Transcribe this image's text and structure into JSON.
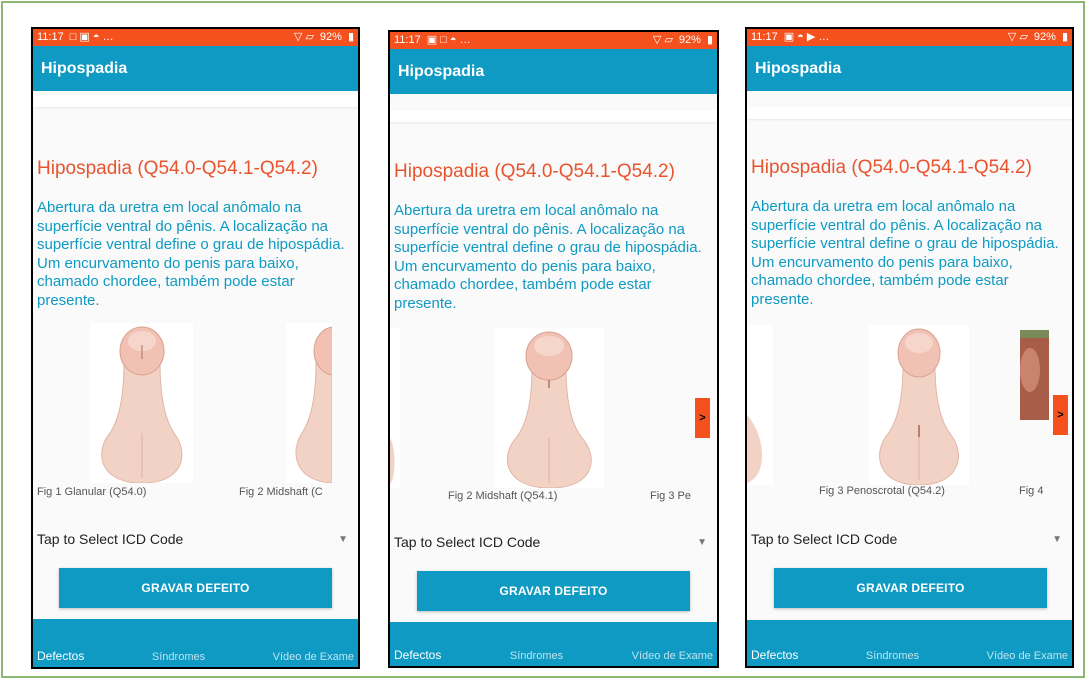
{
  "theme": {
    "status_bar": "#f4511e",
    "primary": "#0e9ac3",
    "accent": "#f4511e",
    "body_text": "#0e9ac3",
    "title_text": "#e8542e"
  },
  "screens": [
    {
      "status": {
        "time": "11:17",
        "left_icons": "□ ▣ ◓ …",
        "battery": "92%"
      },
      "app_title": "Hipospadia",
      "heading": "Hipospadia (Q54.0-Q54.1-Q54.2)",
      "description": "Abertura da uretra em local anômalo na superfície ventral do pênis. A localização na superfície ventral define o grau de hipospádia. Um encurvamento do penis para baixo, chamado chordee, também pode estar presente.",
      "captions": [
        "Fig 1 Glanular (Q54.0)",
        "Fig 2 Midshaft (C"
      ],
      "next_arrow": null,
      "select_label": "Tap to Select ICD Code",
      "button_label": "GRAVAR DEFEITO",
      "nav": {
        "active": "Defectos",
        "items": [
          "Síndromes",
          "Vídeo de Exame"
        ]
      }
    },
    {
      "status": {
        "time": "11:17",
        "left_icons": "▣ □ ◓ …",
        "battery": "92%"
      },
      "app_title": "Hipospadia",
      "heading": "Hipospadia (Q54.0-Q54.1-Q54.2)",
      "description": "Abertura da uretra em local anômalo na superfície ventral do pênis. A localização na superfície ventral define o grau de hipospádia. Um encurvamento do penis para baixo, chamado chordee, também pode estar presente.",
      "captions": [
        "Fig 2 Midshaft (Q54.1)",
        "Fig 3 Pe"
      ],
      "next_arrow": ">",
      "select_label": "Tap to Select ICD Code",
      "button_label": "GRAVAR DEFEITO",
      "nav": {
        "active": "Defectos",
        "items": [
          "Síndromes",
          "Vídeo de Exame"
        ]
      }
    },
    {
      "status": {
        "time": "11:17",
        "left_icons": "▣ ◓ ▶ …",
        "battery": "92%"
      },
      "app_title": "Hipospadia",
      "heading": "Hipospadia (Q54.0-Q54.1-Q54.2)",
      "description": "Abertura da uretra em local anômalo na superfície ventral do pênis. A localização na superfície ventral define o grau de hipospádia. Um encurvamento do penis para baixo, chamado chordee, também pode estar presente.",
      "captions": [
        "Fig 3 Penoscrotal (Q54.2)",
        "Fig 4"
      ],
      "next_arrow": ">",
      "select_label": "Tap to Select ICD Code",
      "button_label": "GRAVAR DEFEITO",
      "nav": {
        "active": "Defectos",
        "items": [
          "Síndromes",
          "Vídeo de Exame"
        ]
      }
    }
  ]
}
